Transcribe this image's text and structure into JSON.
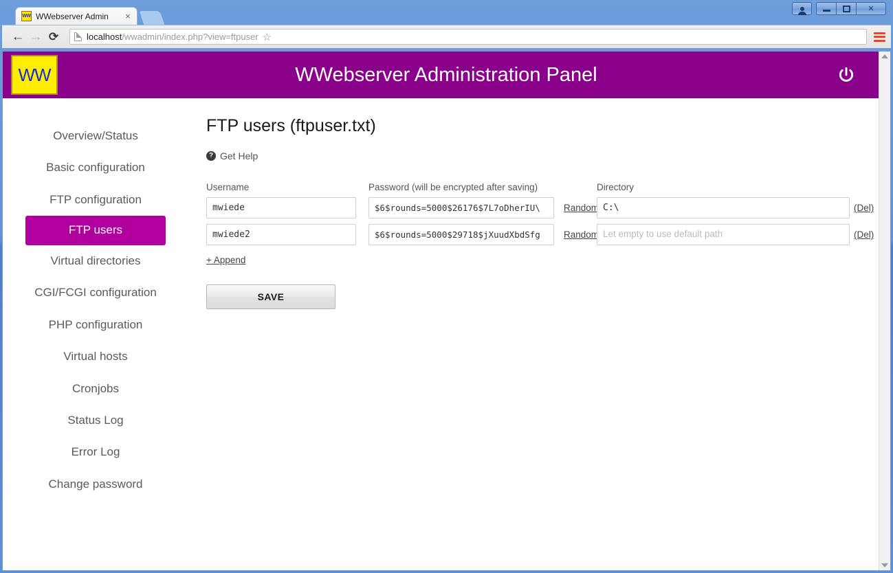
{
  "browser": {
    "tab": {
      "title": "WWebserver Admin",
      "favicon_text": "WW",
      "close_label": "×"
    },
    "nav": {
      "back": "←",
      "forward": "→",
      "reload": "⟳"
    },
    "url": {
      "host": "localhost",
      "path": "/wwadmin/index.php?view=ftpuser"
    },
    "star_glyph": "☆",
    "window_controls": {
      "minimize": "",
      "maximize": "",
      "close": "✕"
    }
  },
  "app": {
    "logo_text": "WW",
    "title": "WWebserver Administration Panel",
    "logout_label": "power-off"
  },
  "sidebar": {
    "items": [
      {
        "label": "Overview/Status",
        "active": false
      },
      {
        "label": "Basic configuration",
        "active": false
      },
      {
        "label": "FTP configuration",
        "active": false
      },
      {
        "label": "FTP users",
        "active": true
      },
      {
        "label": "Virtual directories",
        "active": false
      },
      {
        "label": "CGI/FCGI configuration",
        "active": false
      },
      {
        "label": "PHP configuration",
        "active": false
      },
      {
        "label": "Virtual hosts",
        "active": false
      },
      {
        "label": "Cronjobs",
        "active": false
      },
      {
        "label": "Status Log",
        "active": false
      },
      {
        "label": "Error Log",
        "active": false
      },
      {
        "label": "Change password",
        "active": false
      }
    ]
  },
  "content": {
    "title": "FTP users (ftpuser.txt)",
    "help_link": "Get Help",
    "help_icon": "?",
    "columns": {
      "username": "Username",
      "password": "Password (will be encrypted after saving)",
      "directory": "Directory"
    },
    "rows": [
      {
        "username": "mwiede",
        "password": "$6$rounds=5000$26176$7L7oDherIU\\",
        "directory": "C:\\",
        "directory_placeholder": "Let empty to use default path",
        "random_label": "Random",
        "delete_label": "(Del)"
      },
      {
        "username": "mwiede2",
        "password": "$6$rounds=5000$29718$jXuudXbdSfg",
        "directory": "",
        "directory_placeholder": "Let empty to use default path",
        "random_label": "Random",
        "delete_label": "(Del)"
      }
    ],
    "append_label": "+ Append",
    "save_label": "SAVE"
  },
  "colors": {
    "header_purple": "#8B008B",
    "active_nav": "#b2009e",
    "logo_yellow": "#ffee00",
    "logo_blue": "#1a2fd0"
  }
}
